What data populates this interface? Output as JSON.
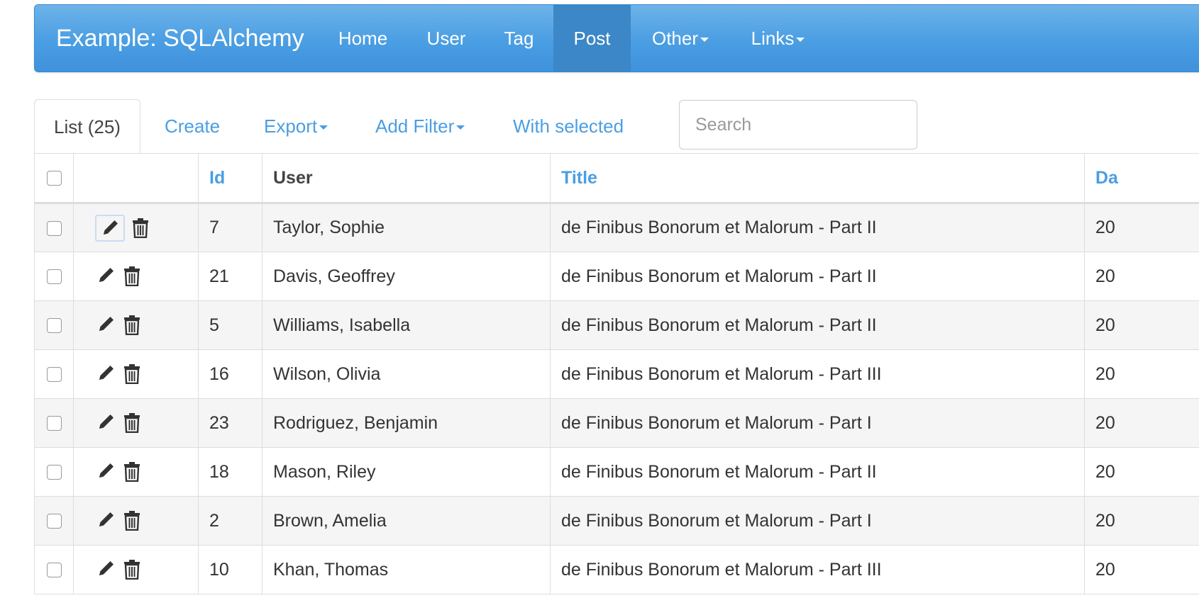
{
  "navbar": {
    "brand": "Example: SQLAlchemy",
    "items": [
      {
        "label": "Home"
      },
      {
        "label": "User"
      },
      {
        "label": "Tag"
      },
      {
        "label": "Post",
        "active": true
      },
      {
        "label": "Other",
        "dropdown": true
      },
      {
        "label": "Links",
        "dropdown": true
      }
    ]
  },
  "tabs": {
    "list": "List (25)",
    "create": "Create",
    "export": "Export",
    "add_filter": "Add Filter",
    "with_selected": "With selected"
  },
  "search": {
    "placeholder": "Search"
  },
  "table": {
    "columns": [
      "",
      "",
      "Id",
      "User",
      "Title",
      "Da"
    ],
    "rows": [
      {
        "id": "7",
        "user": "Taylor, Sophie",
        "title": "de Finibus Bonorum et Malorum - Part II",
        "date": "20"
      },
      {
        "id": "21",
        "user": "Davis, Geoffrey",
        "title": "de Finibus Bonorum et Malorum - Part II",
        "date": "20"
      },
      {
        "id": "5",
        "user": "Williams, Isabella",
        "title": "de Finibus Bonorum et Malorum - Part II",
        "date": "20"
      },
      {
        "id": "16",
        "user": "Wilson, Olivia",
        "title": "de Finibus Bonorum et Malorum - Part III",
        "date": "20"
      },
      {
        "id": "23",
        "user": "Rodriguez, Benjamin",
        "title": "de Finibus Bonorum et Malorum - Part I",
        "date": "20"
      },
      {
        "id": "18",
        "user": "Mason, Riley",
        "title": "de Finibus Bonorum et Malorum - Part II",
        "date": "20"
      },
      {
        "id": "2",
        "user": "Brown, Amelia",
        "title": "de Finibus Bonorum et Malorum - Part I",
        "date": "20"
      },
      {
        "id": "10",
        "user": "Khan, Thomas",
        "title": "de Finibus Bonorum et Malorum - Part III",
        "date": "20"
      }
    ]
  },
  "icons": {
    "edit": "pencil-icon",
    "delete": "trash-icon",
    "caret": "caret-down-icon"
  },
  "colors": {
    "navbar": "#4a9ee3",
    "navbar_active": "#3b87c7",
    "link": "#4a9ee3",
    "border": "#dddddd",
    "row_stripe": "#f5f5f5"
  }
}
